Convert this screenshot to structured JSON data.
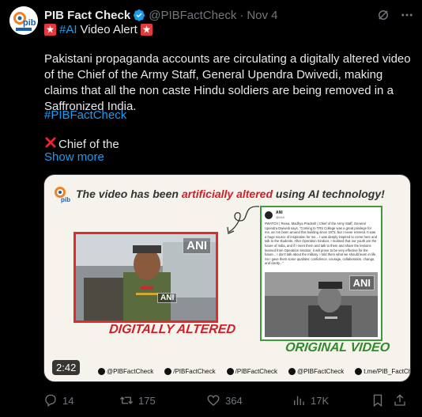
{
  "tweet": {
    "author_name": "PIB Fact Check",
    "handle": "@PIBFactCheck",
    "separator": "·",
    "time": "Nov 4",
    "hashtag_ai": "#AI",
    "video_alert": "Video Alert",
    "body": "Pakistani propaganda accounts are circulating a digitally altered video of the Chief of the Army Staff, General Upendra Dwivedi, making claims that all the non caste Hindu soldiers are being removed in a Saffronized India.",
    "link_hashtag": "#PIBFactCheck",
    "chief_text": "Chief of the",
    "show_more": "Show more"
  },
  "media": {
    "headline_pre": "The video has been ",
    "headline_red": "artificially altered",
    "headline_post": " using AI technology!",
    "label_altered": "DIGITALLY ALTERED",
    "label_original": "ORIGINAL VIDEO",
    "ani_label": "ANI",
    "duration": "2:42",
    "socials": [
      "@PIBFactCheck",
      "/PIBFactCheck",
      "/PIBFactCheck",
      "@PIBFactCheck",
      "t.me/PIB_FactCheck"
    ],
    "orig_caption": "#WATCH | Rewa, Madhya Pradesh | Chief of the Army Staff, General Upendra Dwivedi says, \"Coming to TRS College was a great privilege for me, as I've been around this building since 1973, but I never entered. It was a huge source of inspiration for me... I was deeply inspired to come here and talk to the students. After Operation Sindoor, I realised that our youth are the future of India, and if I meet them and talk to them and share the lessons learned from Operation Sindoor, it will prove to be very effective for the future... I don't talk about the military. I told them what we should learn in life. So I gave them some qualities: confidence, courage, collaboration, change, and clarity...\"",
    "orig_name": "ANI",
    "orig_sub": "@ANI"
  },
  "actions": {
    "replies": "14",
    "reposts": "175",
    "likes": "364",
    "views": "17K"
  },
  "colors": {
    "accent": "#1d9bf0",
    "muted": "#71767b",
    "alert_red": "#d11f2a",
    "original_green": "#2f8a2a"
  }
}
